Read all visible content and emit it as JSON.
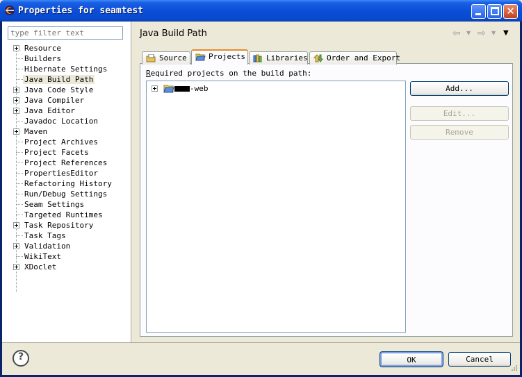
{
  "window": {
    "title": "Properties for seamtest"
  },
  "filter": {
    "placeholder": "type filter text"
  },
  "tree": {
    "items": [
      {
        "label": "Resource",
        "expandable": true
      },
      {
        "label": "Builders",
        "expandable": false
      },
      {
        "label": "Hibernate Settings",
        "expandable": false
      },
      {
        "label": "Java Build Path",
        "expandable": false,
        "selected": true
      },
      {
        "label": "Java Code Style",
        "expandable": true
      },
      {
        "label": "Java Compiler",
        "expandable": true
      },
      {
        "label": "Java Editor",
        "expandable": true
      },
      {
        "label": "Javadoc Location",
        "expandable": false
      },
      {
        "label": "Maven",
        "expandable": true
      },
      {
        "label": "Project Archives",
        "expandable": false
      },
      {
        "label": "Project Facets",
        "expandable": false
      },
      {
        "label": "Project References",
        "expandable": false
      },
      {
        "label": "PropertiesEditor",
        "expandable": false
      },
      {
        "label": "Refactoring History",
        "expandable": false
      },
      {
        "label": "Run/Debug Settings",
        "expandable": false
      },
      {
        "label": "Seam Settings",
        "expandable": false
      },
      {
        "label": "Targeted Runtimes",
        "expandable": false
      },
      {
        "label": "Task Repository",
        "expandable": true
      },
      {
        "label": "Task Tags",
        "expandable": false
      },
      {
        "label": "Validation",
        "expandable": true
      },
      {
        "label": "WikiText",
        "expandable": false
      },
      {
        "label": "XDoclet",
        "expandable": true
      }
    ]
  },
  "page": {
    "title": "Java Build Path",
    "tabs": [
      {
        "label": "Source"
      },
      {
        "label": "Projects",
        "active": true
      },
      {
        "label": "Libraries"
      },
      {
        "label": "Order and Export"
      }
    ],
    "required_label_first": "R",
    "required_label_rest": "equired projects on the build path:",
    "project_name": "-web",
    "buttons": {
      "add": "Add...",
      "edit": "Edit...",
      "remove": "Remove"
    }
  },
  "footer": {
    "ok": "OK",
    "cancel": "Cancel"
  },
  "colors": {
    "titlebar": "#0a4fd8",
    "active_tab_accent": "#e68b2c",
    "dialog_bg": "#ece9d8"
  }
}
